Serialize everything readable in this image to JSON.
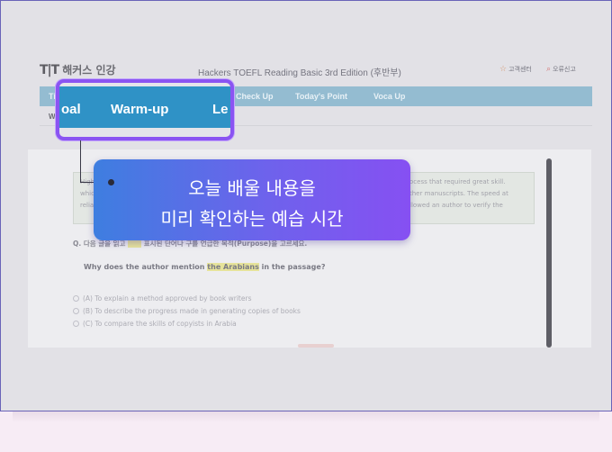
{
  "header": {
    "logo_mark": "T|T",
    "logo_text": "해커스 인강",
    "title": "Hackers TOEFL Reading Basic 3rd Edition (후반부)",
    "links": [
      {
        "icon": "star-icon",
        "label": "고객센터"
      },
      {
        "icon": "magnifier-icon",
        "label": "오류신고"
      }
    ]
  },
  "nav": {
    "items": [
      "Tip",
      "Check Up",
      "Today's Point",
      "Voca Up"
    ],
    "sub_label": "W"
  },
  "zoom": {
    "items": [
      "oal",
      "Warm-up",
      "Le"
    ]
  },
  "passage": {
    "lines": [
      "ocess that required great skill.",
      "ther manuscripts. The speed at",
      "llowed an author to verify the"
    ],
    "left_fragments": [
      "High",
      "whic",
      "relia"
    ]
  },
  "question": {
    "instruction_prefix": "Q. 다음 글을 읽고",
    "instruction_suffix": "표시된 단어나 구를 언급한 목적(Purpose)을 고르세요.",
    "text_prefix": "Why does the author mention ",
    "highlight": "the Arabians",
    "text_suffix": " in the passage?",
    "options": [
      "(A) To explain a method approved by book writers",
      "(B) To describe the progress made in generating copies of books",
      "(C) To compare the skills of copyists in Arabia"
    ]
  },
  "callout": {
    "line1": "오늘 배울 내용을",
    "line2": "미리 확인하는 예습 시간"
  },
  "colors": {
    "accent_purple": "#8a54f2",
    "nav_blue": "#2f92c6",
    "callout_start": "#3e7ee0",
    "callout_end": "#8650f2"
  }
}
